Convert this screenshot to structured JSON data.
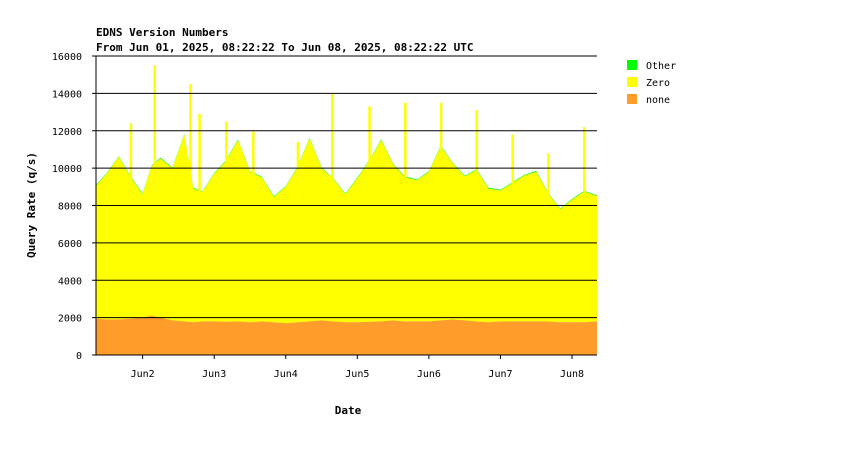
{
  "chart_data": {
    "type": "area",
    "stacked": true,
    "title": "EDNS Version Numbers",
    "subtitle": "From Jun 01, 2025, 08:22:22 To Jun 08, 2025, 08:22:22 UTC",
    "xlabel": "Date",
    "ylabel": "Query Rate (q/s)",
    "ylim": [
      0,
      16000
    ],
    "yticks": [
      0,
      2000,
      4000,
      6000,
      8000,
      10000,
      12000,
      14000,
      16000
    ],
    "xlim": [
      "2025-06-01 08:22",
      "2025-06-08 08:22"
    ],
    "xticks": [
      {
        "x": "2025-06-02",
        "label": "Jun2"
      },
      {
        "x": "2025-06-03",
        "label": "Jun3"
      },
      {
        "x": "2025-06-04",
        "label": "Jun4"
      },
      {
        "x": "2025-06-05",
        "label": "Jun5"
      },
      {
        "x": "2025-06-06",
        "label": "Jun6"
      },
      {
        "x": "2025-06-07",
        "label": "Jun7"
      },
      {
        "x": "2025-06-08",
        "label": "Jun8"
      }
    ],
    "grid": "horizontal",
    "legend_position": "right",
    "x": [
      "Jun 01 08:22",
      "Jun 01 12:00",
      "Jun 01 16:00",
      "Jun 01 20:00",
      "Jun 02 00:00",
      "Jun 02 03:00",
      "Jun 02 06:00",
      "Jun 02 10:00",
      "Jun 02 14:00",
      "Jun 02 17:00",
      "Jun 02 20:00",
      "Jun 03 00:00",
      "Jun 03 04:00",
      "Jun 03 08:00",
      "Jun 03 12:00",
      "Jun 03 16:00",
      "Jun 03 20:00",
      "Jun 04 00:00",
      "Jun 04 04:00",
      "Jun 04 08:00",
      "Jun 04 12:00",
      "Jun 04 16:00",
      "Jun 04 20:00",
      "Jun 05 00:00",
      "Jun 05 04:00",
      "Jun 05 08:00",
      "Jun 05 12:00",
      "Jun 05 16:00",
      "Jun 05 20:00",
      "Jun 06 00:00",
      "Jun 06 04:00",
      "Jun 06 08:00",
      "Jun 06 12:00",
      "Jun 06 16:00",
      "Jun 06 20:00",
      "Jun 07 00:00",
      "Jun 07 04:00",
      "Jun 07 08:00",
      "Jun 07 12:00",
      "Jun 07 16:00",
      "Jun 07 20:00",
      "Jun 08 00:00",
      "Jun 08 04:00",
      "Jun 08 08:22"
    ],
    "series": [
      {
        "name": "none",
        "color": "#ff9c2a",
        "values": [
          1950,
          1900,
          1900,
          1950,
          2000,
          2100,
          2000,
          1850,
          1800,
          1750,
          1800,
          1800,
          1780,
          1800,
          1750,
          1800,
          1750,
          1700,
          1750,
          1800,
          1850,
          1800,
          1750,
          1750,
          1780,
          1800,
          1850,
          1800,
          1800,
          1800,
          1850,
          1900,
          1850,
          1800,
          1750,
          1800,
          1800,
          1800,
          1800,
          1800,
          1750,
          1750,
          1750,
          1800
        ]
      },
      {
        "name": "Zero",
        "color": "#ffff00",
        "values": [
          7100,
          7800,
          8700,
          7550,
          6600,
          8000,
          8500,
          8150,
          10000,
          7150,
          6900,
          7900,
          8600,
          9700,
          8050,
          7700,
          6700,
          7300,
          8300,
          9800,
          8150,
          7600,
          6850,
          7700,
          8600,
          9700,
          8350,
          7700,
          7550,
          8000,
          9300,
          8350,
          7700,
          8100,
          7150,
          7000,
          7400,
          7800,
          8000,
          6850,
          6050,
          6550,
          7000,
          6700
        ]
      },
      {
        "name": "Other",
        "color": "#00ff00",
        "values": [
          50,
          40,
          40,
          50,
          50,
          40,
          50,
          40,
          40,
          50,
          40,
          40,
          50,
          40,
          40,
          40,
          50,
          40,
          40,
          40,
          50,
          40,
          40,
          50,
          40,
          40,
          40,
          50,
          40,
          40,
          50,
          40,
          40,
          40,
          50,
          40,
          40,
          40,
          50,
          40,
          40,
          50,
          40,
          40
        ]
      }
    ],
    "spikes": [
      {
        "x": "Jun 01 20:00",
        "total": 12400
      },
      {
        "x": "Jun 02 04:00",
        "total": 15500
      },
      {
        "x": "Jun 02 16:00",
        "total": 14500
      },
      {
        "x": "Jun 02 19:00",
        "total": 12900
      },
      {
        "x": "Jun 03 04:00",
        "total": 12500
      },
      {
        "x": "Jun 03 13:00",
        "total": 11950
      },
      {
        "x": "Jun 04 04:00",
        "total": 11400
      },
      {
        "x": "Jun 04 15:30",
        "total": 14000
      },
      {
        "x": "Jun 05 04:00",
        "total": 13300
      },
      {
        "x": "Jun 05 16:00",
        "total": 13500
      },
      {
        "x": "Jun 06 04:00",
        "total": 13500
      },
      {
        "x": "Jun 06 16:00",
        "total": 13100
      },
      {
        "x": "Jun 07 04:00",
        "total": 11800
      },
      {
        "x": "Jun 07 16:00",
        "total": 10800
      },
      {
        "x": "Jun 08 04:00",
        "total": 12200
      }
    ]
  }
}
